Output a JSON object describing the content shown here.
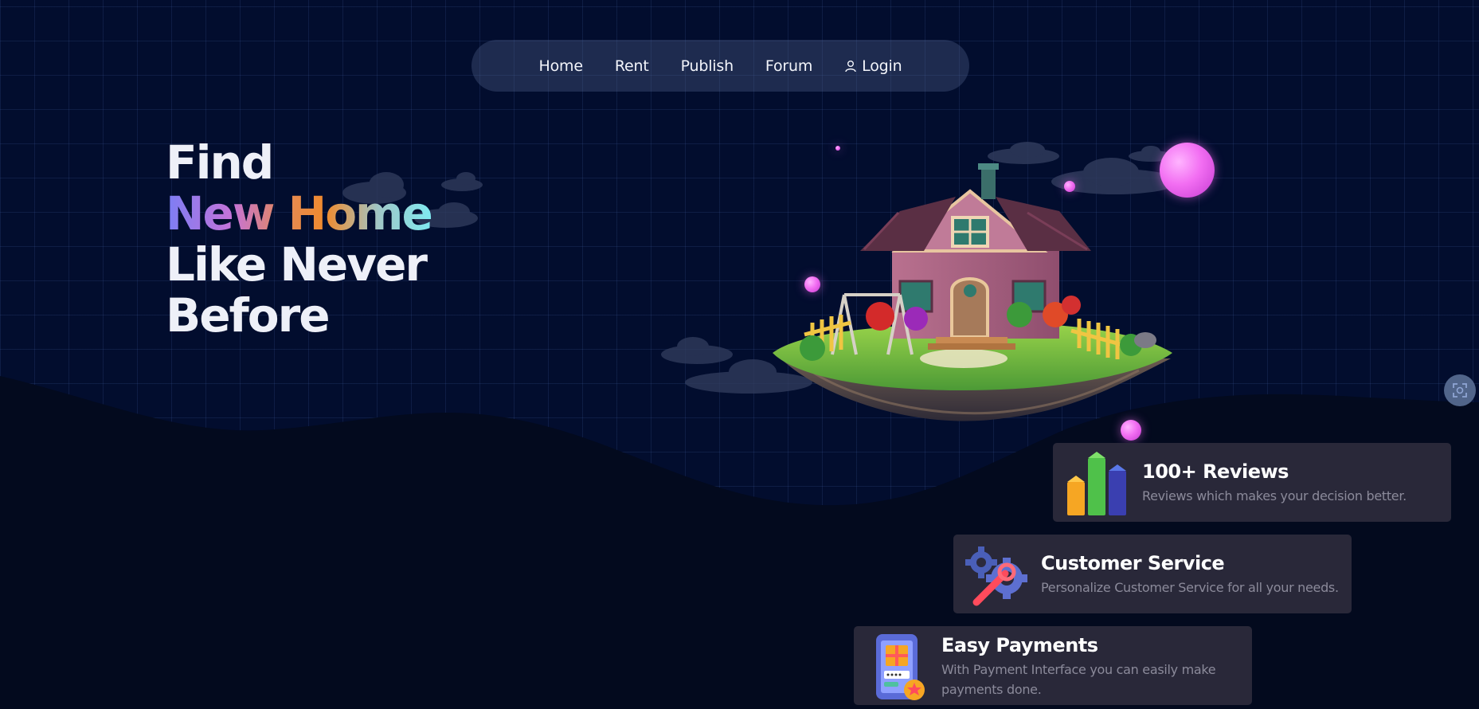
{
  "nav": {
    "items": [
      {
        "label": "Home"
      },
      {
        "label": "Rent"
      },
      {
        "label": "Publish"
      },
      {
        "label": "Forum"
      },
      {
        "label": "Login",
        "icon": "user-icon"
      }
    ]
  },
  "hero": {
    "line1": "Find",
    "line2": "New Home",
    "line3": "Like Never",
    "line4": "Before"
  },
  "features": [
    {
      "title": "100+ Reviews",
      "desc": "Reviews which makes your decision better.",
      "icon": "bar-chart-icon"
    },
    {
      "title": "Customer Service",
      "desc": "Personalize Customer Service for all your needs.",
      "icon": "gears-wrench-icon"
    },
    {
      "title": "Easy Payments",
      "desc": "With Payment Interface you can easily make payments done.",
      "icon": "payment-phone-icon"
    }
  ],
  "colors": {
    "background": "#020d2e",
    "wave": "#030a1e",
    "card": "#2c2a3c",
    "accent_pink": "#f26ef2"
  },
  "side_button": {
    "icon": "scan-icon"
  }
}
